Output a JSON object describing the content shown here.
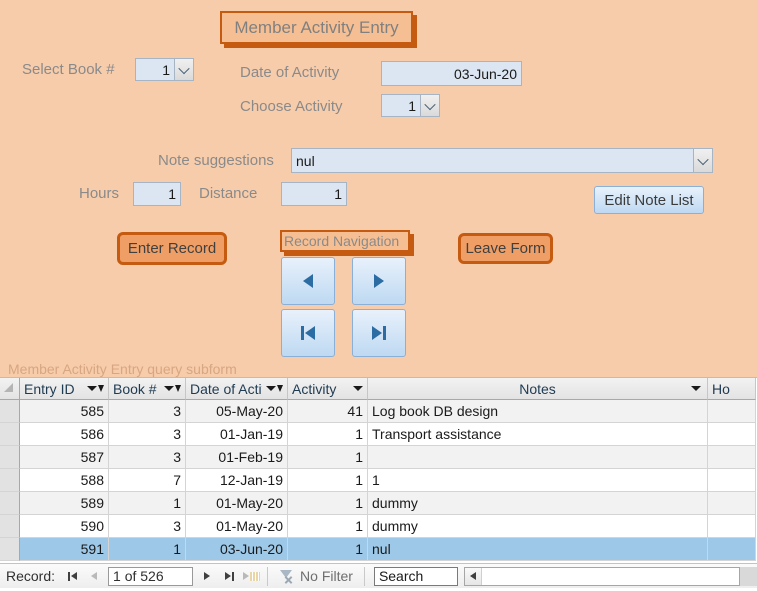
{
  "form": {
    "title": "Member Activity Entry",
    "background_color": "#f7ccab",
    "accent_color": "#c55a11"
  },
  "fields": {
    "select_book_label": "Select Book #",
    "select_book_value": "1",
    "date_label": "Date of Activity",
    "date_value": "03-Jun-20",
    "activity_label": "Choose Activity",
    "activity_value": "1",
    "note_suggestions_label": "Note suggestions",
    "note_suggestions_value": "nul",
    "hours_label": "Hours",
    "hours_value": "1",
    "distance_label": "Distance",
    "distance_value": "1"
  },
  "buttons": {
    "edit_note_list": "Edit Note List",
    "enter_record": "Enter Record",
    "leave_form": "Leave Form",
    "record_navigation_label": "Record Navigation",
    "nav_prev": "previous-record",
    "nav_next": "next-record",
    "nav_first": "first-record",
    "nav_last": "last-record"
  },
  "subform": {
    "caption": "Member Activity Entry query subform",
    "columns": [
      {
        "label": "Entry ID",
        "indicator": "filter"
      },
      {
        "label": "Book #",
        "indicator": "filter"
      },
      {
        "label": "Date of Activi",
        "indicator": "filter"
      },
      {
        "label": "Activity",
        "indicator": "sort"
      },
      {
        "label": "Notes",
        "indicator": "sort"
      },
      {
        "label": "Ho",
        "indicator": "none"
      }
    ],
    "rows": [
      {
        "entry_id": "585",
        "book": "3",
        "date": "05-May-20",
        "activity": "41",
        "notes": "Log book DB design",
        "hours": "",
        "selected": false
      },
      {
        "entry_id": "586",
        "book": "3",
        "date": "01-Jan-19",
        "activity": "1",
        "notes": "Transport assistance",
        "hours": "",
        "selected": false
      },
      {
        "entry_id": "587",
        "book": "3",
        "date": "01-Feb-19",
        "activity": "1",
        "notes": "",
        "hours": "",
        "selected": false
      },
      {
        "entry_id": "588",
        "book": "7",
        "date": "12-Jan-19",
        "activity": "1",
        "notes": "1",
        "hours": "",
        "selected": false
      },
      {
        "entry_id": "589",
        "book": "1",
        "date": "01-May-20",
        "activity": "1",
        "notes": "dummy",
        "hours": "",
        "selected": false
      },
      {
        "entry_id": "590",
        "book": "3",
        "date": "01-May-20",
        "activity": "1",
        "notes": "dummy",
        "hours": "",
        "selected": false
      },
      {
        "entry_id": "591",
        "book": "1",
        "date": "03-Jun-20",
        "activity": "1",
        "notes": "nul",
        "hours": "",
        "selected": true
      }
    ]
  },
  "navigator": {
    "record_label": "Record:",
    "position": "1 of 526",
    "filter_status": "No Filter",
    "search_placeholder": "Search",
    "search_value": ""
  }
}
